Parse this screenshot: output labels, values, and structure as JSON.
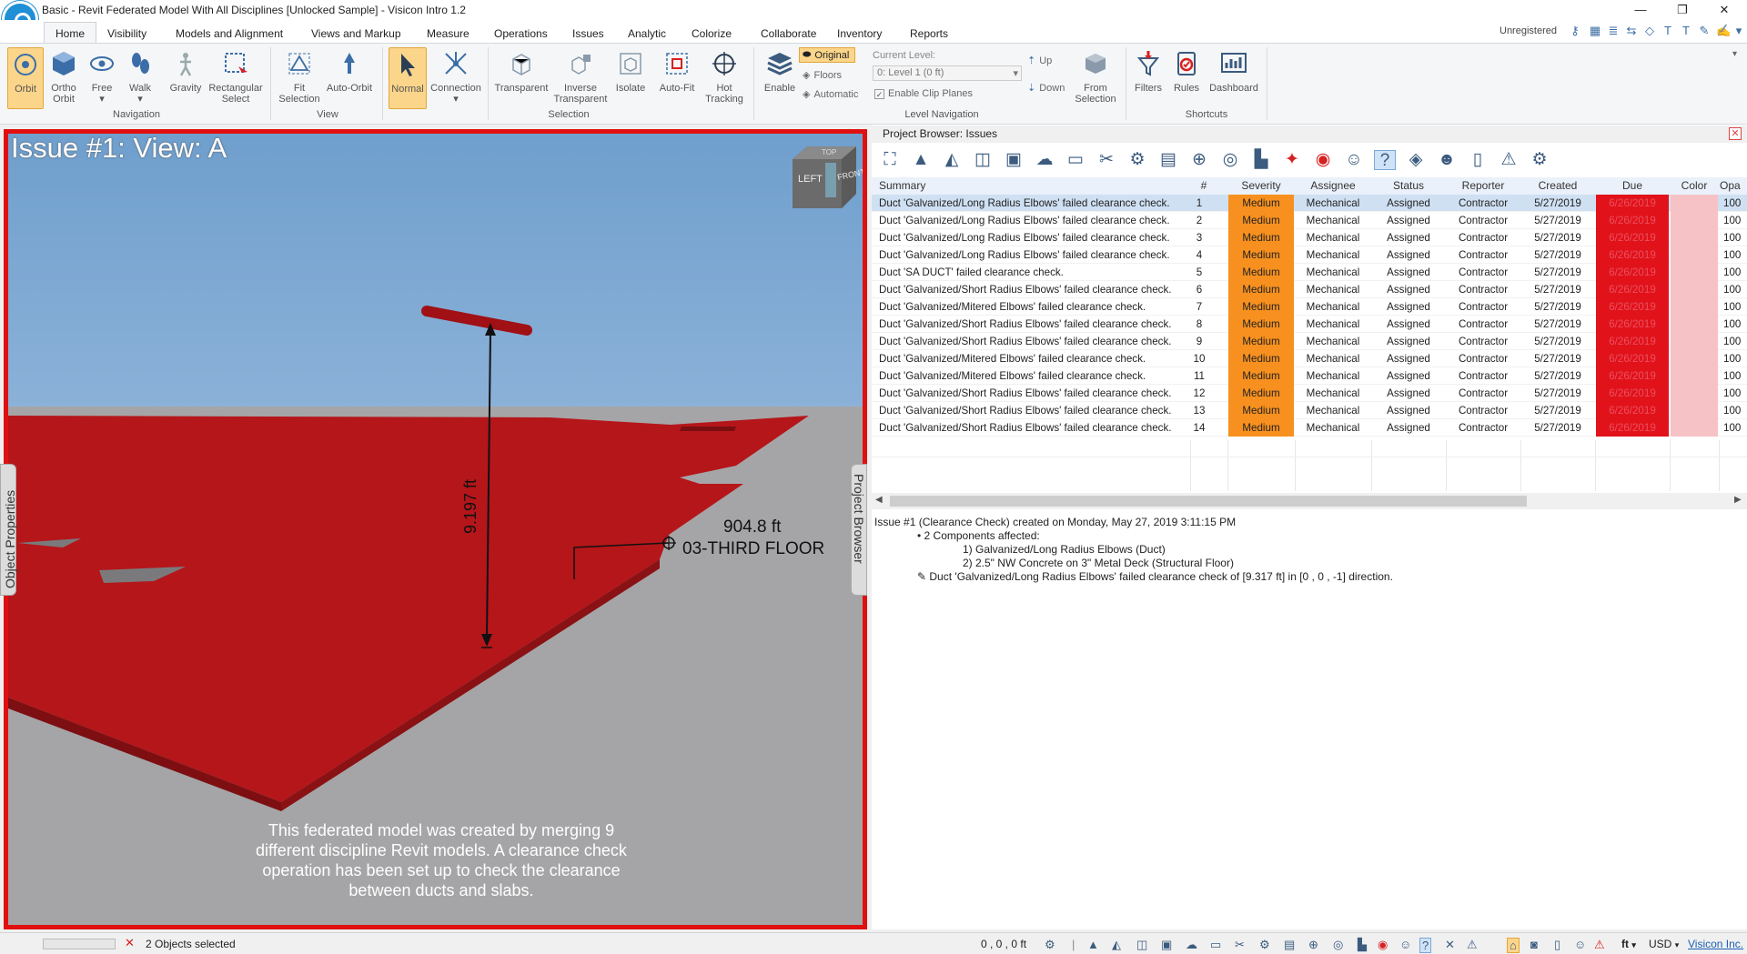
{
  "window": {
    "title": "Basic - Revit Federated Model With All Disciplines [Unlocked Sample] - Visicon Intro 1.2",
    "min": "—",
    "restore": "❐",
    "close": "✕"
  },
  "tabs": [
    "Home",
    "Visibility",
    "Models and Alignment",
    "Views and Markup",
    "Measure",
    "Operations",
    "Issues",
    "Analytic",
    "Colorize",
    "Collaborate",
    "Inventory",
    "Reports"
  ],
  "license": "Unregistered",
  "ribbon": {
    "navigation": {
      "orbit": "Orbit",
      "ortho_orbit_1": "Ortho",
      "ortho_orbit_2": "Orbit",
      "free": "Free",
      "walk": "Walk",
      "gravity": "Gravity",
      "rect_select_1": "Rectangular",
      "rect_select_2": "Select",
      "label": "Navigation"
    },
    "view": {
      "fit_1": "Fit",
      "fit_2": "Selection",
      "auto_orbit": "Auto-Orbit",
      "label": "View"
    },
    "selection": {
      "normal": "Normal",
      "connection": "Connection",
      "transparent": "Transparent",
      "inv_1": "Inverse",
      "inv_2": "Transparent",
      "isolate": "Isolate",
      "autofit": "Auto-Fit",
      "hot_1": "Hot",
      "hot_2": "Tracking",
      "label": "Selection"
    },
    "level_nav": {
      "enable": "Enable",
      "original": "Original",
      "floors": "Floors",
      "automatic": "Automatic",
      "current_level_label": "Current Level:",
      "current_level_value": "0: Level 1 (0 ft)",
      "clip_planes": "Enable Clip Planes",
      "up": "Up",
      "down": "Down",
      "from_sel_1": "From",
      "from_sel_2": "Selection",
      "label": "Level Navigation"
    },
    "shortcuts": {
      "filters": "Filters",
      "rules": "Rules",
      "dashboard": "Dashboard",
      "label": "Shortcuts"
    }
  },
  "viewport": {
    "issue_title": "Issue #1: View: A",
    "dimension": "9.197 ft",
    "elevation": "904.8 ft",
    "floor": "03-THIRD FLOOR",
    "cube_left": "LEFT",
    "cube_front": "FRONT",
    "cube_top": "TOP",
    "caption": "This federated model was created by merging 9 different discipline Revit models. A clearance check operation has been set up to check the clearance between ducts and slabs.",
    "left_tab": "Object Properties",
    "right_tab": "Project Browser"
  },
  "browser": {
    "title": "Project Browser: Issues",
    "columns": [
      "Summary",
      "#",
      "Severity",
      "Assignee",
      "Status",
      "Reporter",
      "Created",
      "Due",
      "Color",
      "Opa"
    ],
    "rows": [
      {
        "summary": "Duct 'Galvanized/Long Radius Elbows' failed clearance check.",
        "num": "1",
        "severity": "Medium",
        "assignee": "Mechanical",
        "status": "Assigned",
        "reporter": "Contractor",
        "created": "5/27/2019",
        "due": "6/26/2019",
        "opa": "100"
      },
      {
        "summary": "Duct 'Galvanized/Long Radius Elbows' failed clearance check.",
        "num": "2",
        "severity": "Medium",
        "assignee": "Mechanical",
        "status": "Assigned",
        "reporter": "Contractor",
        "created": "5/27/2019",
        "due": "6/26/2019",
        "opa": "100"
      },
      {
        "summary": "Duct 'Galvanized/Long Radius Elbows' failed clearance check.",
        "num": "3",
        "severity": "Medium",
        "assignee": "Mechanical",
        "status": "Assigned",
        "reporter": "Contractor",
        "created": "5/27/2019",
        "due": "6/26/2019",
        "opa": "100"
      },
      {
        "summary": "Duct 'Galvanized/Long Radius Elbows' failed clearance check.",
        "num": "4",
        "severity": "Medium",
        "assignee": "Mechanical",
        "status": "Assigned",
        "reporter": "Contractor",
        "created": "5/27/2019",
        "due": "6/26/2019",
        "opa": "100"
      },
      {
        "summary": "Duct 'SA DUCT' failed clearance check.",
        "num": "5",
        "severity": "Medium",
        "assignee": "Mechanical",
        "status": "Assigned",
        "reporter": "Contractor",
        "created": "5/27/2019",
        "due": "6/26/2019",
        "opa": "100"
      },
      {
        "summary": "Duct 'Galvanized/Short Radius Elbows' failed clearance check.",
        "num": "6",
        "severity": "Medium",
        "assignee": "Mechanical",
        "status": "Assigned",
        "reporter": "Contractor",
        "created": "5/27/2019",
        "due": "6/26/2019",
        "opa": "100"
      },
      {
        "summary": "Duct 'Galvanized/Mitered Elbows' failed clearance check.",
        "num": "7",
        "severity": "Medium",
        "assignee": "Mechanical",
        "status": "Assigned",
        "reporter": "Contractor",
        "created": "5/27/2019",
        "due": "6/26/2019",
        "opa": "100"
      },
      {
        "summary": "Duct 'Galvanized/Short Radius Elbows' failed clearance check.",
        "num": "8",
        "severity": "Medium",
        "assignee": "Mechanical",
        "status": "Assigned",
        "reporter": "Contractor",
        "created": "5/27/2019",
        "due": "6/26/2019",
        "opa": "100"
      },
      {
        "summary": "Duct 'Galvanized/Short Radius Elbows' failed clearance check.",
        "num": "9",
        "severity": "Medium",
        "assignee": "Mechanical",
        "status": "Assigned",
        "reporter": "Contractor",
        "created": "5/27/2019",
        "due": "6/26/2019",
        "opa": "100"
      },
      {
        "summary": "Duct 'Galvanized/Mitered Elbows' failed clearance check.",
        "num": "10",
        "severity": "Medium",
        "assignee": "Mechanical",
        "status": "Assigned",
        "reporter": "Contractor",
        "created": "5/27/2019",
        "due": "6/26/2019",
        "opa": "100"
      },
      {
        "summary": "Duct 'Galvanized/Mitered Elbows' failed clearance check.",
        "num": "11",
        "severity": "Medium",
        "assignee": "Mechanical",
        "status": "Assigned",
        "reporter": "Contractor",
        "created": "5/27/2019",
        "due": "6/26/2019",
        "opa": "100"
      },
      {
        "summary": "Duct 'Galvanized/Short Radius Elbows' failed clearance check.",
        "num": "12",
        "severity": "Medium",
        "assignee": "Mechanical",
        "status": "Assigned",
        "reporter": "Contractor",
        "created": "5/27/2019",
        "due": "6/26/2019",
        "opa": "100"
      },
      {
        "summary": "Duct 'Galvanized/Short Radius Elbows' failed clearance check.",
        "num": "13",
        "severity": "Medium",
        "assignee": "Mechanical",
        "status": "Assigned",
        "reporter": "Contractor",
        "created": "5/27/2019",
        "due": "6/26/2019",
        "opa": "100"
      },
      {
        "summary": "Duct 'Galvanized/Short Radius Elbows' failed clearance check.",
        "num": "14",
        "severity": "Medium",
        "assignee": "Mechanical",
        "status": "Assigned",
        "reporter": "Contractor",
        "created": "5/27/2019",
        "due": "6/26/2019",
        "opa": "100"
      }
    ],
    "details": {
      "header": "Issue #1 (Clearance Check) created on Monday, May 27, 2019 3:11:15 PM",
      "components": "• 2 Components affected:",
      "comp1": "1) Galvanized/Long Radius Elbows (Duct)",
      "comp2": "2) 2.5\" NW Concrete on 3\" Metal Deck (Structural Floor)",
      "note": "✎ Duct 'Galvanized/Long Radius Elbows' failed clearance check of [9.317 ft] in [0 , 0 , -1] direction."
    }
  },
  "statusbar": {
    "selected": "2 Objects selected",
    "coords": "0 , 0 , 0 ft",
    "units": "ft",
    "currency": "USD",
    "company": "Visicon Inc."
  },
  "colors": {
    "severity": "#f7901e",
    "due": "#e2121a",
    "slab": "#b5161a",
    "accent": "#1f8fd6"
  }
}
